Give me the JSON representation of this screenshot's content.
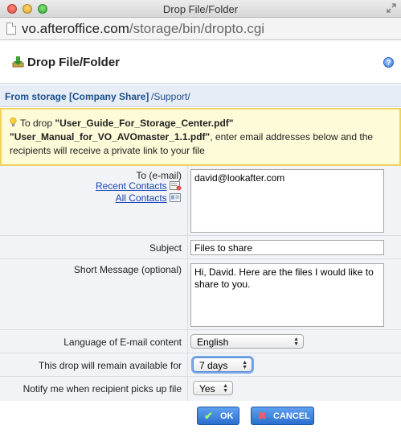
{
  "window": {
    "title": "Drop File/Folder"
  },
  "urlbar": {
    "host": "vo.afteroffice.com",
    "path": "/storage/bin/dropto.cgi"
  },
  "header": {
    "title": "Drop File/Folder",
    "help_label": "?"
  },
  "breadcrumb": {
    "storage": "From storage [Company Share]",
    "path": "/Support/"
  },
  "notice": {
    "prefix": "To drop",
    "files": "\"User_Guide_For_Storage_Center.pdf\" \"User_Manual_for_VO_AVOmaster_1.1.pdf\"",
    "suffix": ", enter email addresses below and the recipients will receive a private link to your file"
  },
  "form": {
    "to_label": "To (e-mail)",
    "recent_contacts": "Recent Contacts",
    "all_contacts": "All Contacts",
    "to_value": "david@lookafter.com",
    "subject_label": "Subject",
    "subject_value": "Files to share",
    "message_label": "Short Message (optional)",
    "message_value": "Hi, David. Here are the files I would like to share to you.",
    "language_label": "Language of E-mail content",
    "language_value": "English",
    "availability_label": "This drop will remain available for",
    "availability_value": "7 days",
    "notify_label": "Notify me when recipient picks up file",
    "notify_value": "Yes"
  },
  "buttons": {
    "ok": "OK",
    "cancel": "CANCEL"
  }
}
